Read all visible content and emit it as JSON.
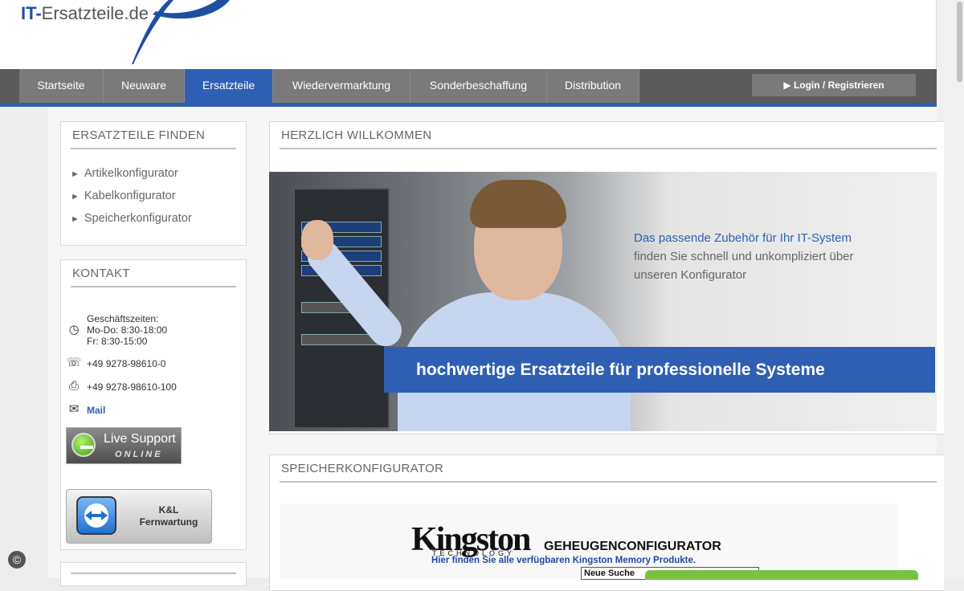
{
  "logo": {
    "prefix": "IT-",
    "name": "Ersatzteile.de"
  },
  "nav": {
    "items": [
      {
        "label": "Startseite"
      },
      {
        "label": "Neuware"
      },
      {
        "label": "Ersatzteile"
      },
      {
        "label": "Wiedervermarktung"
      },
      {
        "label": "Sonderbeschaffung"
      },
      {
        "label": "Distribution"
      }
    ],
    "active": "Ersatzteile",
    "login_label": "Login / Registrieren"
  },
  "sidebar": {
    "find": {
      "title": "ERSATZTEILE FINDEN",
      "links": [
        "Artikelkonfigurator",
        "Kabelkonfigurator",
        "Speicherkonfigurator"
      ]
    },
    "contact": {
      "title": "KONTAKT",
      "hours_label": "Geschäftszeiten:",
      "hours_weekdays": "Mo-Do: 8:30-18:00",
      "hours_friday": "Fr: 8:30-15:00",
      "phone": "+49 9278-98610-0",
      "fax": "+49 9278-98610-100",
      "mail": "Mail",
      "live_support": "Live Support",
      "live_status": "ONLINE",
      "remote_line1": "K&L",
      "remote_line2": "Fernwartung"
    }
  },
  "welcome": {
    "title": "HERZLICH WILLKOMMEN",
    "headline": "Das passende Zubehör für Ihr IT-System",
    "text_line1": "finden Sie schnell und unkompliziert über",
    "text_line2": "unseren Konfigurator",
    "banner": "hochwertige Ersatzteile für professionelle Systeme"
  },
  "memory": {
    "title": "SPEICHERKONFIGURATOR",
    "brand": "Kingston",
    "brand_sub": "TECHNOLOGY",
    "heading": "GEHEUGENCONFIGURATOR",
    "subtitle": "Hier finden Sie alle verfügbaren Kingston Memory Produkte.",
    "search_label": "Neue Suche"
  },
  "colors": {
    "brand_blue": "#2f5fb3",
    "nav_gray": "#7a7a7a",
    "live_green": "#7ac143"
  }
}
